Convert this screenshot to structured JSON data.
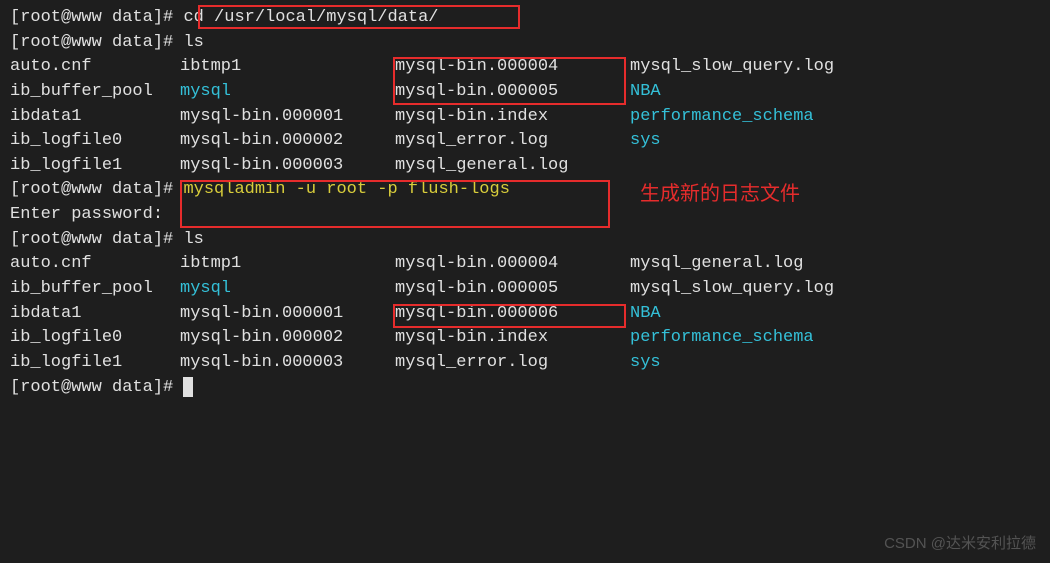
{
  "prompt": "[root@www data]#",
  "cmd_cd": "cd /usr/local/mysql/data/",
  "cmd_ls1": "ls",
  "cmd_flush": "mysqladmin -u root -p flush-logs",
  "enter_pw": "Enter password:",
  "cmd_ls2": "ls",
  "ls1": {
    "r1c1": "auto.cnf",
    "r1c2": "ibtmp1",
    "r1c3": "mysql-bin.000004",
    "r1c4": "mysql_slow_query.log",
    "r2c1": "ib_buffer_pool",
    "r2c2": "mysql",
    "r2c3": "mysql-bin.000005",
    "r2c4": "NBA",
    "r3c1": "ibdata1",
    "r3c2": "mysql-bin.000001",
    "r3c3": "mysql-bin.index",
    "r3c4": "performance_schema",
    "r4c1": "ib_logfile0",
    "r4c2": "mysql-bin.000002",
    "r4c3": "mysql_error.log",
    "r4c4": "sys",
    "r5c1": "ib_logfile1",
    "r5c2": "mysql-bin.000003",
    "r5c3": "mysql_general.log"
  },
  "ls2": {
    "r1c1": "auto.cnf",
    "r1c2": "ibtmp1",
    "r1c3": "mysql-bin.000004",
    "r1c4": "mysql_general.log",
    "r2c1": "ib_buffer_pool",
    "r2c2": "mysql",
    "r2c3": "mysql-bin.000005",
    "r2c4": "mysql_slow_query.log",
    "r3c1": "ibdata1",
    "r3c2": "mysql-bin.000001",
    "r3c3": "mysql-bin.000006",
    "r3c4": "NBA",
    "r4c1": "ib_logfile0",
    "r4c2": "mysql-bin.000002",
    "r4c3": "mysql-bin.index",
    "r4c4": "performance_schema",
    "r5c1": "ib_logfile1",
    "r5c2": "mysql-bin.000003",
    "r5c3": "mysql_error.log",
    "r5c4": "sys"
  },
  "annotation": "生成新的日志文件",
  "watermark": "CSDN @达米安利拉德"
}
